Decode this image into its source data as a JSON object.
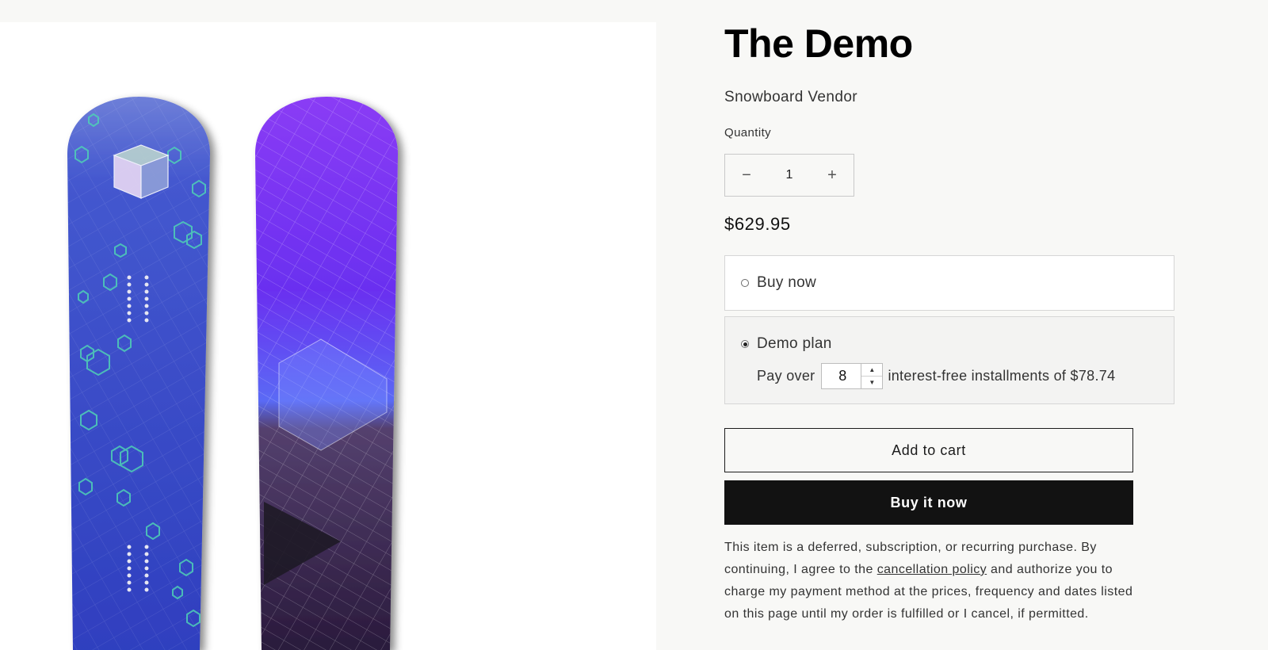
{
  "product": {
    "title": "The Demo",
    "vendor": "Snowboard Vendor",
    "price": "$629.95",
    "image_alt": "Two snowboards with blue hexagon and purple grid graphics"
  },
  "quantity": {
    "label": "Quantity",
    "value": "1",
    "decrease_symbol": "−",
    "increase_symbol": "+"
  },
  "purchase_options": {
    "buy_now": {
      "label": "Buy now",
      "selected": false
    },
    "demo_plan": {
      "label": "Demo plan",
      "selected": true,
      "pay_over_prefix": "Pay over",
      "installments_value": "8",
      "installments_suffix": "interest-free installments of $78.74"
    }
  },
  "buttons": {
    "add_to_cart": "Add to cart",
    "buy_it_now": "Buy it now"
  },
  "disclaimer": {
    "text_before_link": "This item is a deferred, subscription, or recurring purchase. By continuing, I agree to the ",
    "link_text": "cancellation policy",
    "text_after_link": " and authorize you to charge my payment method at the prices, frequency and dates listed on this page until my order is fulfilled or I cancel, if permitted."
  },
  "colors": {
    "page_bg": "#f8f8f6",
    "primary_button": "#121212",
    "board_left": "#3a4cc8",
    "board_right": "#7a2df0"
  }
}
